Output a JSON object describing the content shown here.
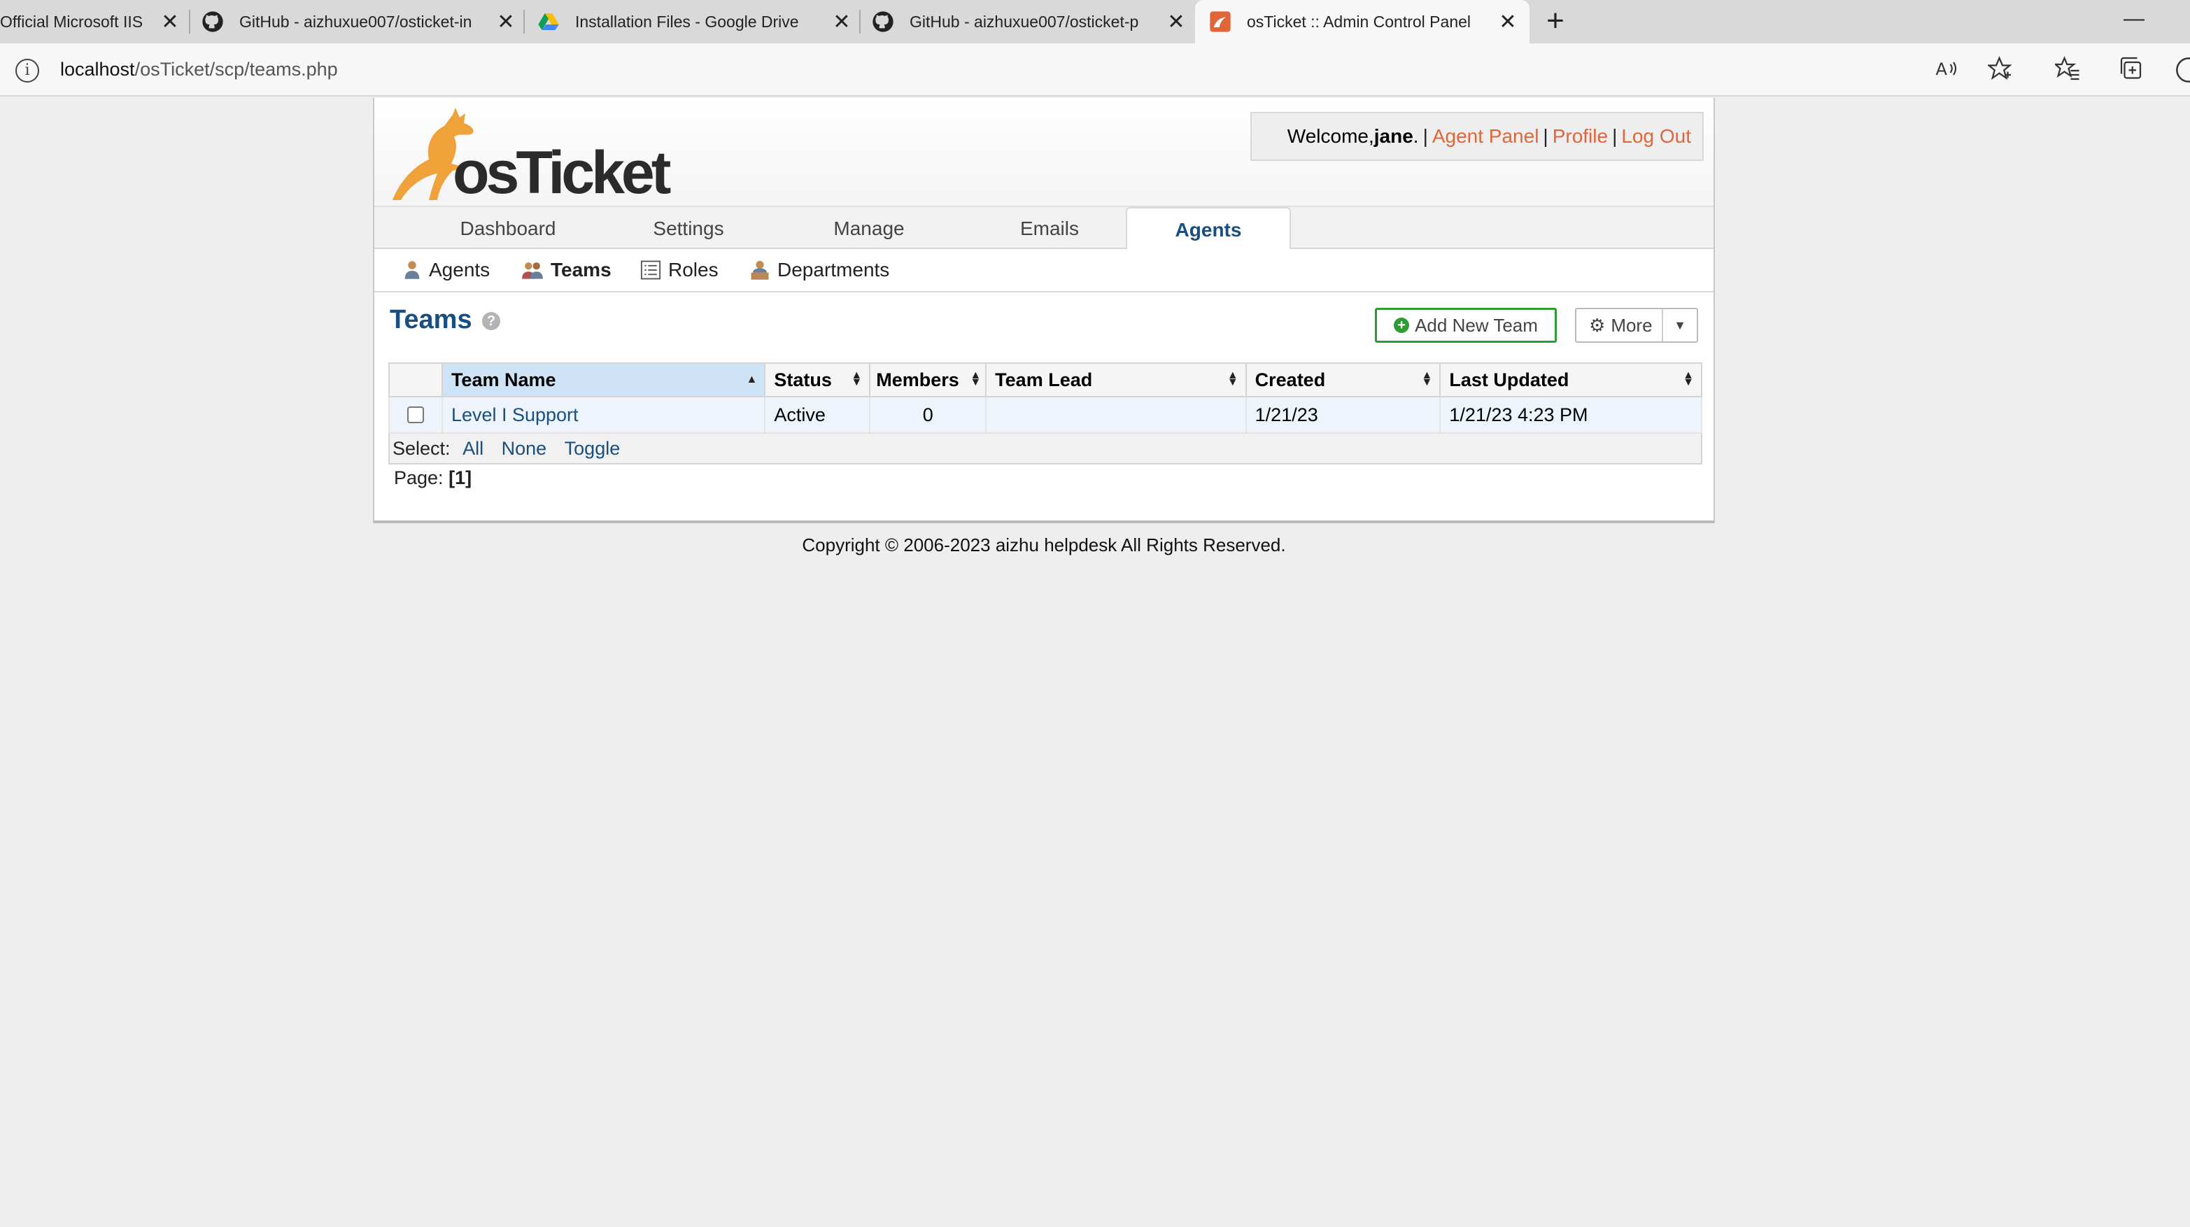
{
  "browser": {
    "tabs": [
      {
        "title": "Official Microsoft IIS",
        "icon": "windows-icon"
      },
      {
        "title": "GitHub - aizhuxue007/osticket-in",
        "icon": "github-icon"
      },
      {
        "title": "Installation Files - Google Drive",
        "icon": "google-drive-icon"
      },
      {
        "title": "GitHub - aizhuxue007/osticket-p",
        "icon": "github-icon"
      },
      {
        "title": "osTicket :: Admin Control Panel",
        "icon": "osticket-icon",
        "active": true
      }
    ],
    "new_tab_symbol": "+",
    "minimize_symbol": "—",
    "url_host": "localhost",
    "url_path": "/osTicket/scp/teams.php"
  },
  "header": {
    "logo_text": "osTicket",
    "welcome_prefix": "Welcome, ",
    "user": "jane",
    "welcome_suffix": ".",
    "links": [
      "Agent Panel",
      "Profile",
      "Log Out"
    ],
    "separator": "|"
  },
  "nav": {
    "main": [
      "Dashboard",
      "Settings",
      "Manage",
      "Emails",
      "Agents"
    ],
    "active": "Agents",
    "sub": [
      "Agents",
      "Teams",
      "Roles",
      "Departments"
    ],
    "sub_active": "Teams"
  },
  "content": {
    "title": "Teams",
    "help_symbol": "?",
    "add_button": "Add New Team",
    "more_button": "More",
    "table": {
      "headers": [
        "Team Name",
        "Status",
        "Members",
        "Team Lead",
        "Created",
        "Last Updated"
      ],
      "rows": [
        {
          "name": "Level I Support",
          "status": "Active",
          "members": "0",
          "lead": "",
          "created": "1/21/23",
          "updated": "1/21/23 4:23 PM"
        }
      ]
    },
    "select_label": "Select:",
    "select_options": [
      "All",
      "None",
      "Toggle"
    ],
    "page_label": "Page:",
    "page_current": "[1]"
  },
  "footer": {
    "copyright": "Copyright © 2006-2023 aizhu helpdesk All Rights Reserved."
  },
  "colors": {
    "link_orange": "#e0663a",
    "title_blue": "#184e81",
    "add_green": "#2e9c34",
    "sorted_header": "#cfe3f6"
  }
}
